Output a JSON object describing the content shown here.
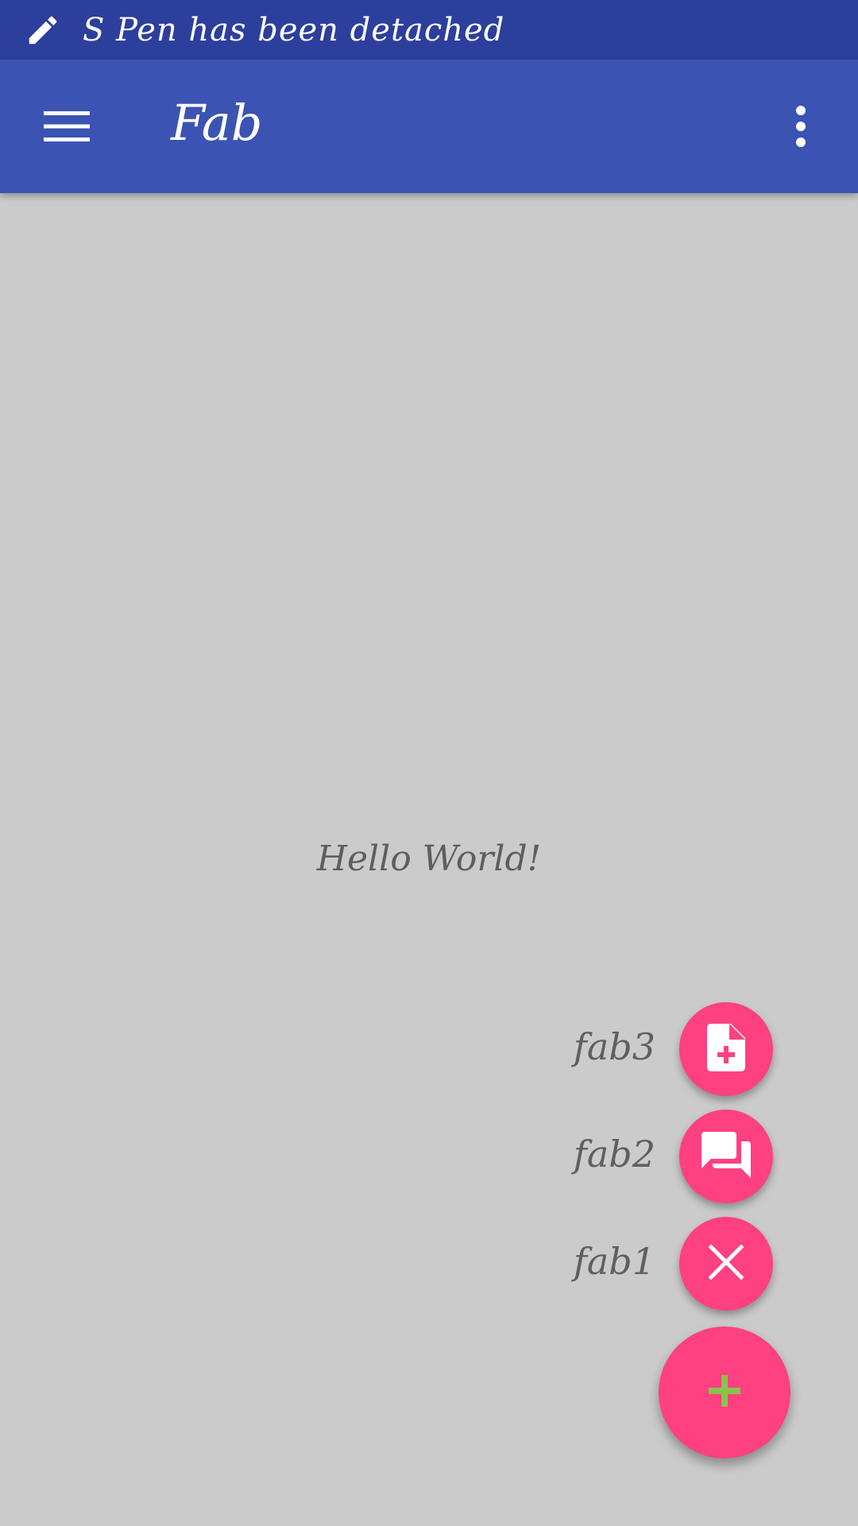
{
  "status_bar": {
    "text": "S Pen has been detached",
    "icon": "pen-icon",
    "background": "#2d3f9c"
  },
  "app_bar": {
    "title": "Fab",
    "menu_icon": "hamburger-menu-icon",
    "overflow_icon": "more-vert-icon",
    "background": "#3b53b3"
  },
  "content": {
    "hello_text": "Hello World!"
  },
  "fab_menu": {
    "accent": "#ff4081",
    "items": [
      {
        "label": "fab3",
        "icon": "note-add-icon"
      },
      {
        "label": "fab2",
        "icon": "forum-icon"
      },
      {
        "label": "fab1",
        "icon": "close-icon"
      }
    ],
    "main_icon": "plus-icon",
    "main_icon_color": "#8bc34a"
  }
}
